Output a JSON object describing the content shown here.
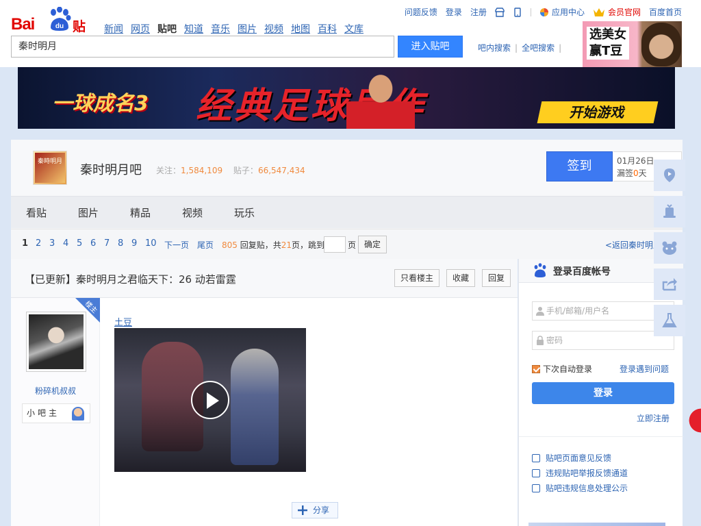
{
  "header": {
    "logo_bai": "Bai",
    "logo_du": "du",
    "logo_tieba": "贴吧",
    "nav": [
      "新闻",
      "网页",
      "贴吧",
      "知道",
      "音乐",
      "图片",
      "视频",
      "地图",
      "百科",
      "文库"
    ],
    "top_links": {
      "feedback": "问题反馈",
      "login": "登录",
      "register": "注册",
      "app_center": "应用中心",
      "vip": "会员官网",
      "home": "百度首页"
    },
    "search_value": "秦时明月",
    "search_button": "进入贴吧",
    "inner_search": "吧内搜索",
    "global_search": "全吧搜索",
    "ad_text_1": "选美女",
    "ad_text_2": "赢T豆"
  },
  "banner": {
    "game_name": "一球成名3",
    "slogan": "经典足球巨作",
    "cta": "开始游戏"
  },
  "forum": {
    "name": "秦时明月吧",
    "follow_label": "关注：",
    "follow_count": "1,584,109",
    "posts_label": "贴子：",
    "posts_count": "66,547,434",
    "sign_button": "签到",
    "date": "01月26日",
    "streak_prefix": "漏签",
    "streak_num": "0",
    "streak_suffix": "天",
    "tabs": [
      "看贴",
      "图片",
      "精品",
      "视频",
      "玩乐"
    ],
    "logo_text": "秦時明月"
  },
  "pager": {
    "pages": [
      "1",
      "2",
      "3",
      "4",
      "5",
      "6",
      "7",
      "8",
      "9",
      "10"
    ],
    "next": "下一页",
    "last": "尾页",
    "reply_count": "805",
    "reply_label": "回复贴，共",
    "page_count": "21",
    "page_suffix": "页，跳到",
    "page_unit": "页",
    "ok": "确定",
    "back": "<返回秦时明月吧"
  },
  "thread": {
    "title": "【已更新】秦时明月之君临天下：26 动若雷霆",
    "only_op": "只看楼主",
    "favorite": "收藏",
    "reply": "回复",
    "op_badge": "楼主",
    "author": "粉碎机叔叔",
    "role": "小吧主",
    "link": "土豆",
    "share": "分享"
  },
  "login": {
    "title": "登录百度帐号",
    "user_placeholder": "手机/邮箱/用户名",
    "pass_placeholder": "密码",
    "remember": "下次自动登录",
    "issue": "登录遇到问题",
    "submit": "登录",
    "register": "立即注册",
    "links": [
      "贴吧页面意见反馈",
      "违规贴吧举报反馈通道",
      "贴吧违规信息处理公示"
    ]
  },
  "colors": {
    "brand_blue": "#3385ff",
    "link_blue": "#2d64b3",
    "sign_blue": "#3d79f2",
    "accent_orange": "#f08a3e",
    "baidu_red": "#e10602"
  }
}
